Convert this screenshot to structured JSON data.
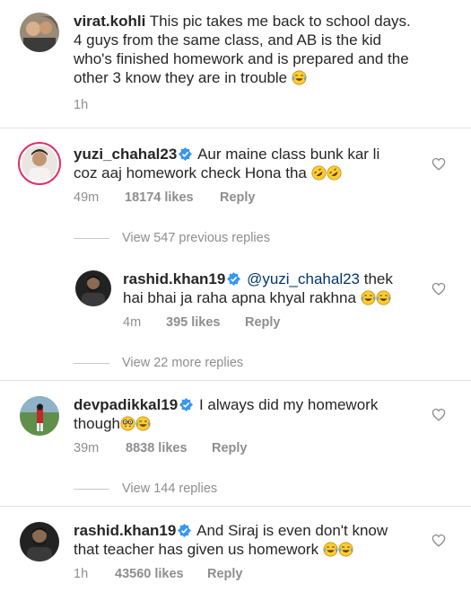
{
  "post": {
    "username": "virat.kohli",
    "caption_l1": "This pic takes me back to school days.",
    "caption_l2": "4 guys from the same class, and  AB is the kid",
    "caption_l3": "who's finished homework and is prepared and the",
    "caption_l4": "other 3 know they are in trouble",
    "time": "1h"
  },
  "comments": [
    {
      "username": "yuzi_chahal23",
      "verified": true,
      "text_l1": "Aur maine class bunk kar li",
      "text_l2": "coz aaj homework check Hona tha",
      "time": "49m",
      "likes": "18174 likes",
      "reply": "Reply",
      "view_replies": "View 547 previous replies"
    },
    {
      "username": "rashid.khan19",
      "verified": true,
      "mention": "@yuzi_chahal23",
      "text_l1_rest": "thek",
      "text_l2": "hai bhai ja raha apna khyal rakhna",
      "time": "4m",
      "likes": "395 likes",
      "reply": "Reply",
      "view_replies": "View 22 more replies"
    },
    {
      "username": "devpadikkal19",
      "verified": true,
      "text_l1": "I always did my homework",
      "text_l2": "though",
      "time": "39m",
      "likes": "8838 likes",
      "reply": "Reply",
      "view_replies": "View 144 replies"
    },
    {
      "username": "rashid.khan19",
      "verified": true,
      "text_l1": "And Siraj is even don't know",
      "text_l2": "that teacher has given us homework",
      "time": "1h",
      "likes": "43560 likes",
      "reply": "Reply"
    }
  ],
  "icons": {
    "like": "heart-outline-icon",
    "verified": "verified-badge-icon",
    "laughing": "face-with-tears-of-joy-emoji",
    "rofl": "rolling-on-floor-laughing-emoji",
    "nerd": "nerd-face-emoji"
  },
  "colors": {
    "verified": "#3897f0",
    "link": "#00376b",
    "muted": "#8e8e8e",
    "story_ring": "#e1306c"
  }
}
